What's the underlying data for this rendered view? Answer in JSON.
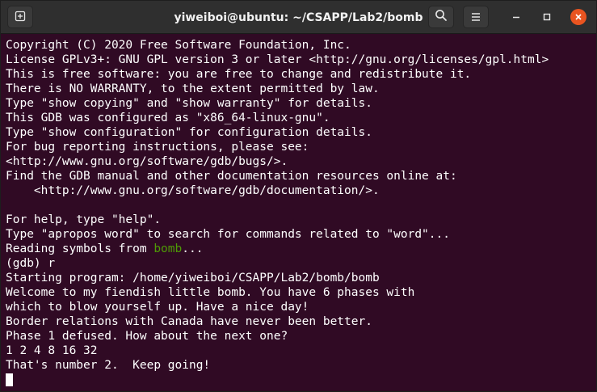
{
  "window": {
    "title": "yiweiboi@ubuntu: ~/CSAPP/Lab2/bomb",
    "new_tab_icon": "new-tab-icon",
    "search_icon": "search-icon",
    "menu_icon": "hamburger-menu-icon",
    "minimize_icon": "minimize-icon",
    "maximize_icon": "maximize-icon",
    "close_icon": "close-icon",
    "close_color": "#e95420",
    "background_color": "#300a24"
  },
  "terminal": {
    "lines": [
      "Copyright (C) 2020 Free Software Foundation, Inc.",
      "License GPLv3+: GNU GPL version 3 or later <http://gnu.org/licenses/gpl.html>",
      "This is free software: you are free to change and redistribute it.",
      "There is NO WARRANTY, to the extent permitted by law.",
      "Type \"show copying\" and \"show warranty\" for details.",
      "This GDB was configured as \"x86_64-linux-gnu\".",
      "Type \"show configuration\" for configuration details.",
      "For bug reporting instructions, please see:",
      "<http://www.gnu.org/software/gdb/bugs/>.",
      "Find the GDB manual and other documentation resources online at:",
      "    <http://www.gnu.org/software/gdb/documentation/>.",
      "",
      "For help, type \"help\".",
      "Type \"apropos word\" to search for commands related to \"word\"..."
    ],
    "reading_prefix": "Reading symbols from ",
    "reading_file": "bomb",
    "reading_suffix": "...",
    "lines2": [
      "(gdb) r",
      "Starting program: /home/yiweiboi/CSAPP/Lab2/bomb/bomb",
      "Welcome to my fiendish little bomb. You have 6 phases with",
      "which to blow yourself up. Have a nice day!",
      "Border relations with Canada have never been better.",
      "Phase 1 defused. How about the next one?",
      "1 2 4 8 16 32",
      "That's number 2.  Keep going!"
    ],
    "text_color": "#ffffff",
    "filename_color": "#4e9a06"
  }
}
